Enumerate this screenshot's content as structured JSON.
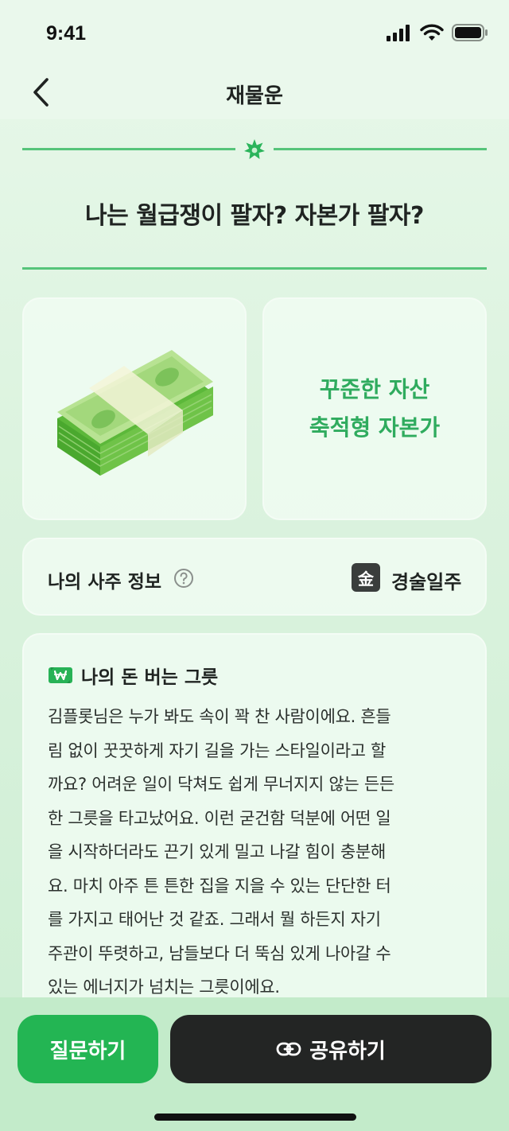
{
  "status_bar": {
    "time": "9:41"
  },
  "nav": {
    "title": "재물운"
  },
  "headline": "나는 월급쟁이 팔자? 자본가 팔자?",
  "result_type": {
    "line1": "꾸준한 자산",
    "line2": "축적형 자본가"
  },
  "saju": {
    "label": "나의 사주 정보",
    "element_badge": "金",
    "pillar": "경술일주"
  },
  "vessel": {
    "title": "나의 돈 버는 그릇",
    "lines": [
      "김플롯님은 누가 봐도 속이 꽉 찬 사람이에요. 흔들",
      "림 없이 꿋꿋하게 자기 길을 가는 스타일이라고 할",
      "까요? 어려운 일이 닥쳐도 쉽게 무너지지 않는 든든",
      "한 그릇을 타고났어요. 이런 굳건함 덕분에 어떤 일",
      "을 시작하더라도 끈기 있게 밀고 나갈 힘이 충분해",
      "요. 마치 아주 튼 튼한 집을 지을 수 있는 단단한 터",
      "를 가지고 태어난 것 같죠. 그래서 뭘 하든지 자기",
      "주관이 뚜렷하고, 남들보다 더 뚝심 있게 나아갈 수",
      "있는 에너지가 넘치는 그릇이에요."
    ]
  },
  "buttons": {
    "ask": "질문하기",
    "share": "공유하기"
  },
  "colors": {
    "accent": "#23b553",
    "dark": "#232524",
    "result_text": "#2fab5e"
  },
  "icons": [
    "signal-icon",
    "wifi-icon",
    "battery-icon",
    "back-chevron-icon",
    "sparkle-icon",
    "money-stack-icon",
    "help-icon",
    "won-bill-icon",
    "link-icon"
  ]
}
